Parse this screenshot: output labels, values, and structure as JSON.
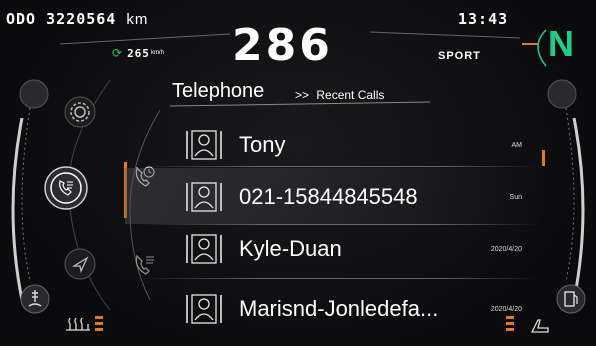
{
  "status_bar": {
    "odometer_label": "ODO",
    "odometer_value": "3220564",
    "odometer_unit": "km",
    "clock": "13:43"
  },
  "cluster": {
    "speed": "286",
    "range_value": "265",
    "range_unit": "km/h",
    "drive_mode": "SPORT",
    "gear": "N"
  },
  "header": {
    "title": "Telephone",
    "breadcrumb_chevron": ">>",
    "breadcrumb": "Recent Calls"
  },
  "calls": [
    {
      "name": "Tony",
      "time": "AM"
    },
    {
      "name": "021-15844845548",
      "time": "Sun"
    },
    {
      "name": "Kyle-Duan",
      "time": "2020/4/20"
    },
    {
      "name": "Marisnd-Jonledefa...",
      "time": "2020/4/20"
    }
  ],
  "sidebar": {
    "items": [
      {
        "icon": "gear-icon"
      },
      {
        "icon": "phone-icon"
      },
      {
        "icon": "navigation-icon"
      }
    ]
  },
  "submenu": {
    "items": [
      {
        "icon": "recent-calls-icon"
      },
      {
        "icon": "contacts-icon"
      }
    ]
  },
  "colors": {
    "accent": "#e07a25",
    "gear": "#18d089",
    "range_icon": "#1ec15c",
    "background": "#0b0b0d"
  }
}
